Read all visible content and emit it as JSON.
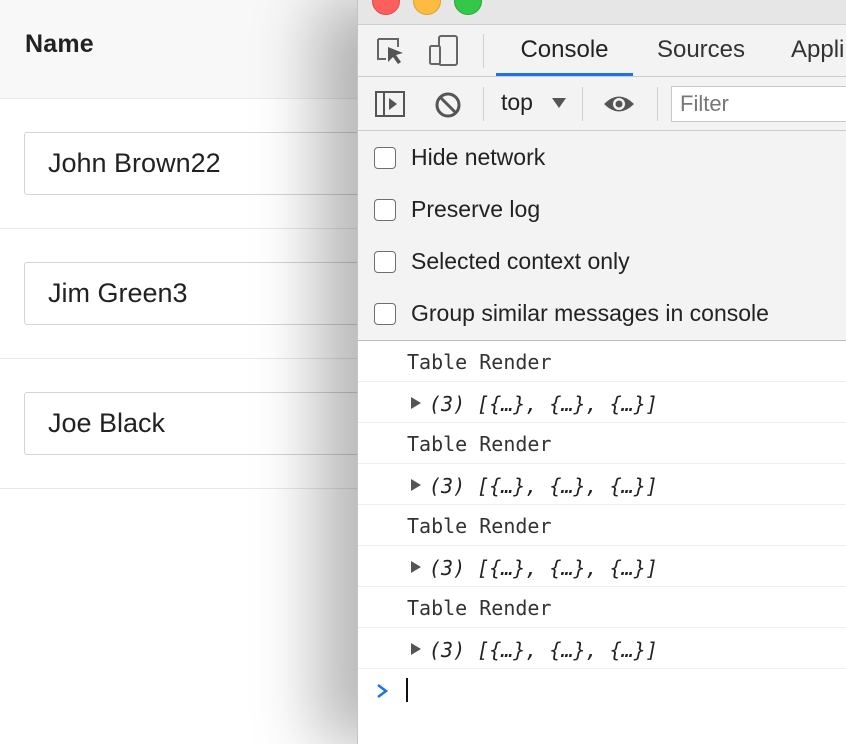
{
  "table": {
    "header": "Name",
    "rows": [
      {
        "value": "John Brown22"
      },
      {
        "value": "Jim Green3"
      },
      {
        "value": "Joe Black"
      }
    ]
  },
  "devtools": {
    "tabs": [
      {
        "label": "Console",
        "active": true
      },
      {
        "label": "Sources",
        "active": false
      },
      {
        "label": "Appli",
        "active": false
      }
    ],
    "toolbar": {
      "context": "top",
      "filter_placeholder": "Filter"
    },
    "settings": [
      {
        "label": "Hide network",
        "checked": false
      },
      {
        "label": "Preserve log",
        "checked": false
      },
      {
        "label": "Selected context only",
        "checked": false
      },
      {
        "label": "Group similar messages in console",
        "checked": false
      }
    ],
    "messages": [
      {
        "kind": "text",
        "text": "Table Render"
      },
      {
        "kind": "object",
        "text": "(3) [{…}, {…}, {…}]"
      },
      {
        "kind": "text",
        "text": "Table Render"
      },
      {
        "kind": "object",
        "text": "(3) [{…}, {…}, {…}]"
      },
      {
        "kind": "text",
        "text": "Table Render"
      },
      {
        "kind": "object",
        "text": "(3) [{…}, {…}, {…}]"
      },
      {
        "kind": "text",
        "text": "Table Render"
      },
      {
        "kind": "object",
        "text": "(3) [{…}, {…}, {…}]"
      }
    ]
  },
  "icons": {
    "window": [
      "close-light",
      "minimize-light",
      "zoom-light"
    ],
    "toolbar": [
      "inspect-element-icon",
      "device-toggle-icon",
      "sidebar-toggle-icon",
      "clear-console-icon",
      "dropdown-caret-icon",
      "eye-icon"
    ],
    "console": [
      "expand-triangle-icon",
      "prompt-chevron-icon"
    ]
  },
  "colors": {
    "accent": "#1a73e8",
    "prompt": "#1a73e8",
    "mac_red": "#fc605c",
    "mac_yellow": "#fdbc40",
    "mac_green": "#34c84a"
  }
}
